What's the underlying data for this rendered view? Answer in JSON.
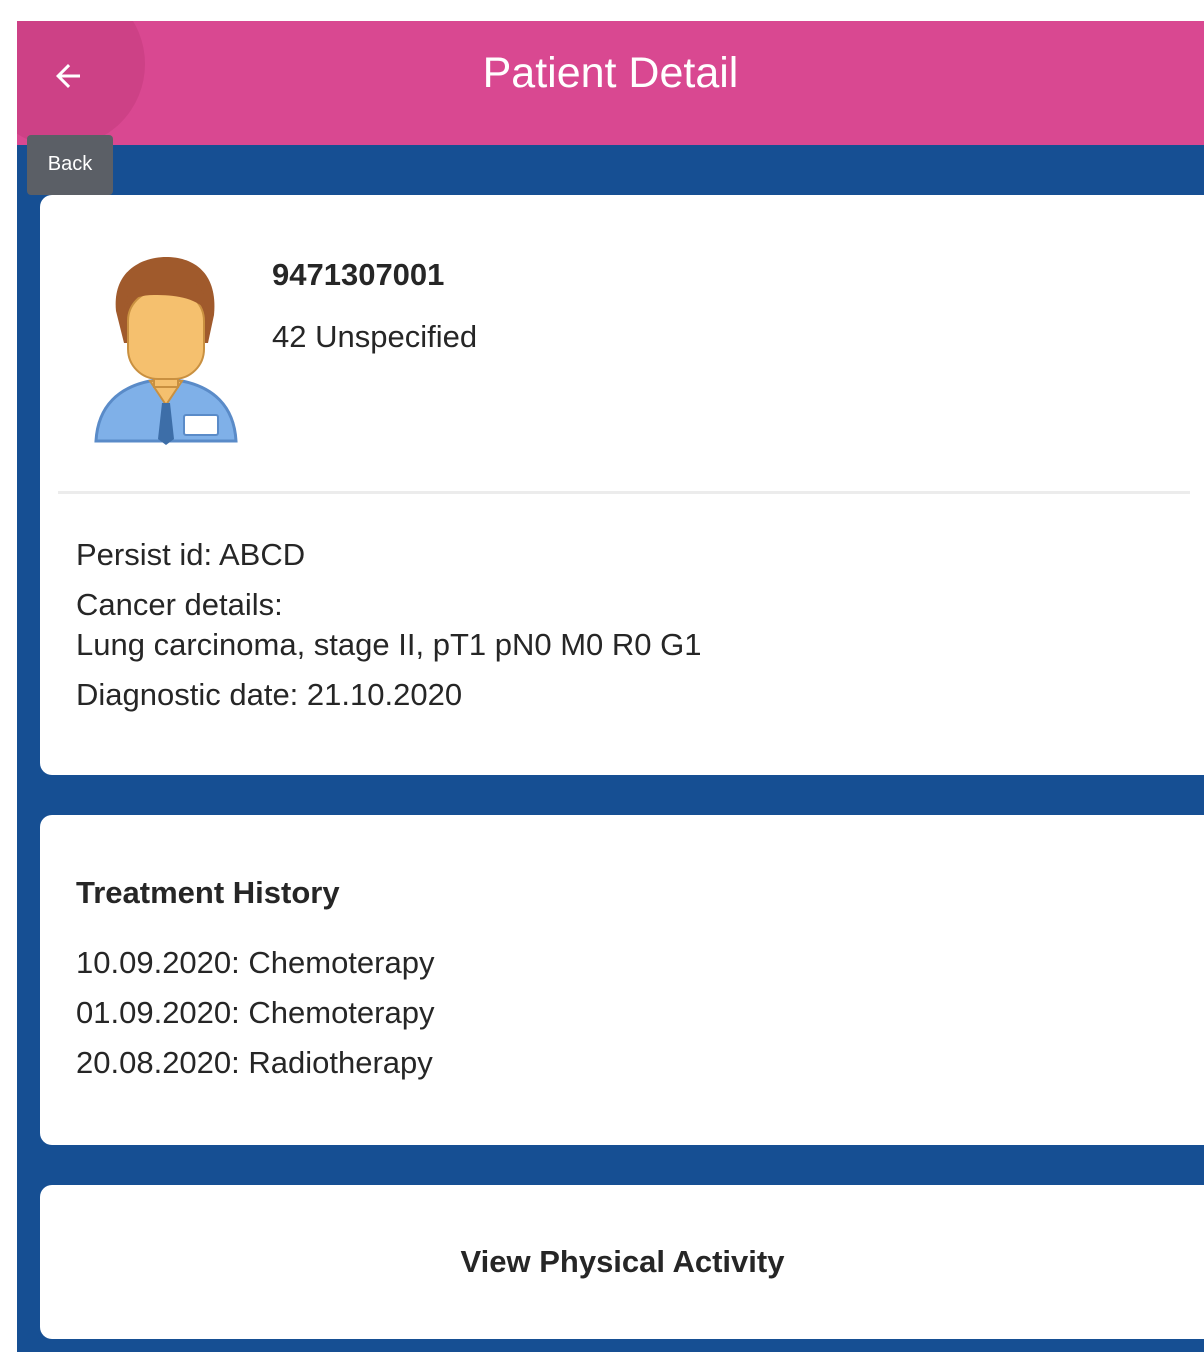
{
  "header": {
    "title": "Patient Detail",
    "back_icon": "arrow-left-icon",
    "back_tooltip": "Back",
    "background_color": "#d94891"
  },
  "page": {
    "background_color": "#164f93"
  },
  "patient": {
    "avatar_icon": "male-patient-avatar-icon",
    "id": "9471307001",
    "meta": "42 Unspecified",
    "persist_id": "Persist id: ABCD",
    "cancer_details_label": "Cancer details:",
    "cancer_details_value": "Lung carcinoma, stage II, pT1 pN0 M0 R0 G1",
    "diagnostic_date": "Diagnostic date: 21.10.2020"
  },
  "treatment_history": {
    "title": "Treatment History",
    "items": [
      "10.09.2020: Chemoterapy",
      "01.09.2020: Chemoterapy",
      "20.08.2020: Radiotherapy"
    ]
  },
  "actions": {
    "view_activity_label": "View Physical Activity"
  }
}
